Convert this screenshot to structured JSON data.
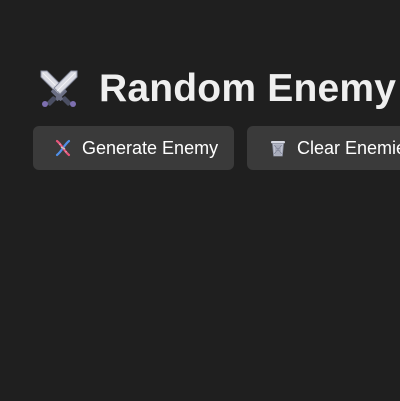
{
  "header": {
    "title": "Random Enemy",
    "title_icon": "crossed-swords-icon"
  },
  "actions": {
    "generate_label": "Generate Enemy",
    "generate_icon": "dna-icon",
    "clear_label": "Clear Enemies",
    "clear_icon": "wastebasket-icon"
  },
  "theme": {
    "background": "#1f1f1f",
    "button_background": "#3a3a3a",
    "text": "#efefef"
  }
}
